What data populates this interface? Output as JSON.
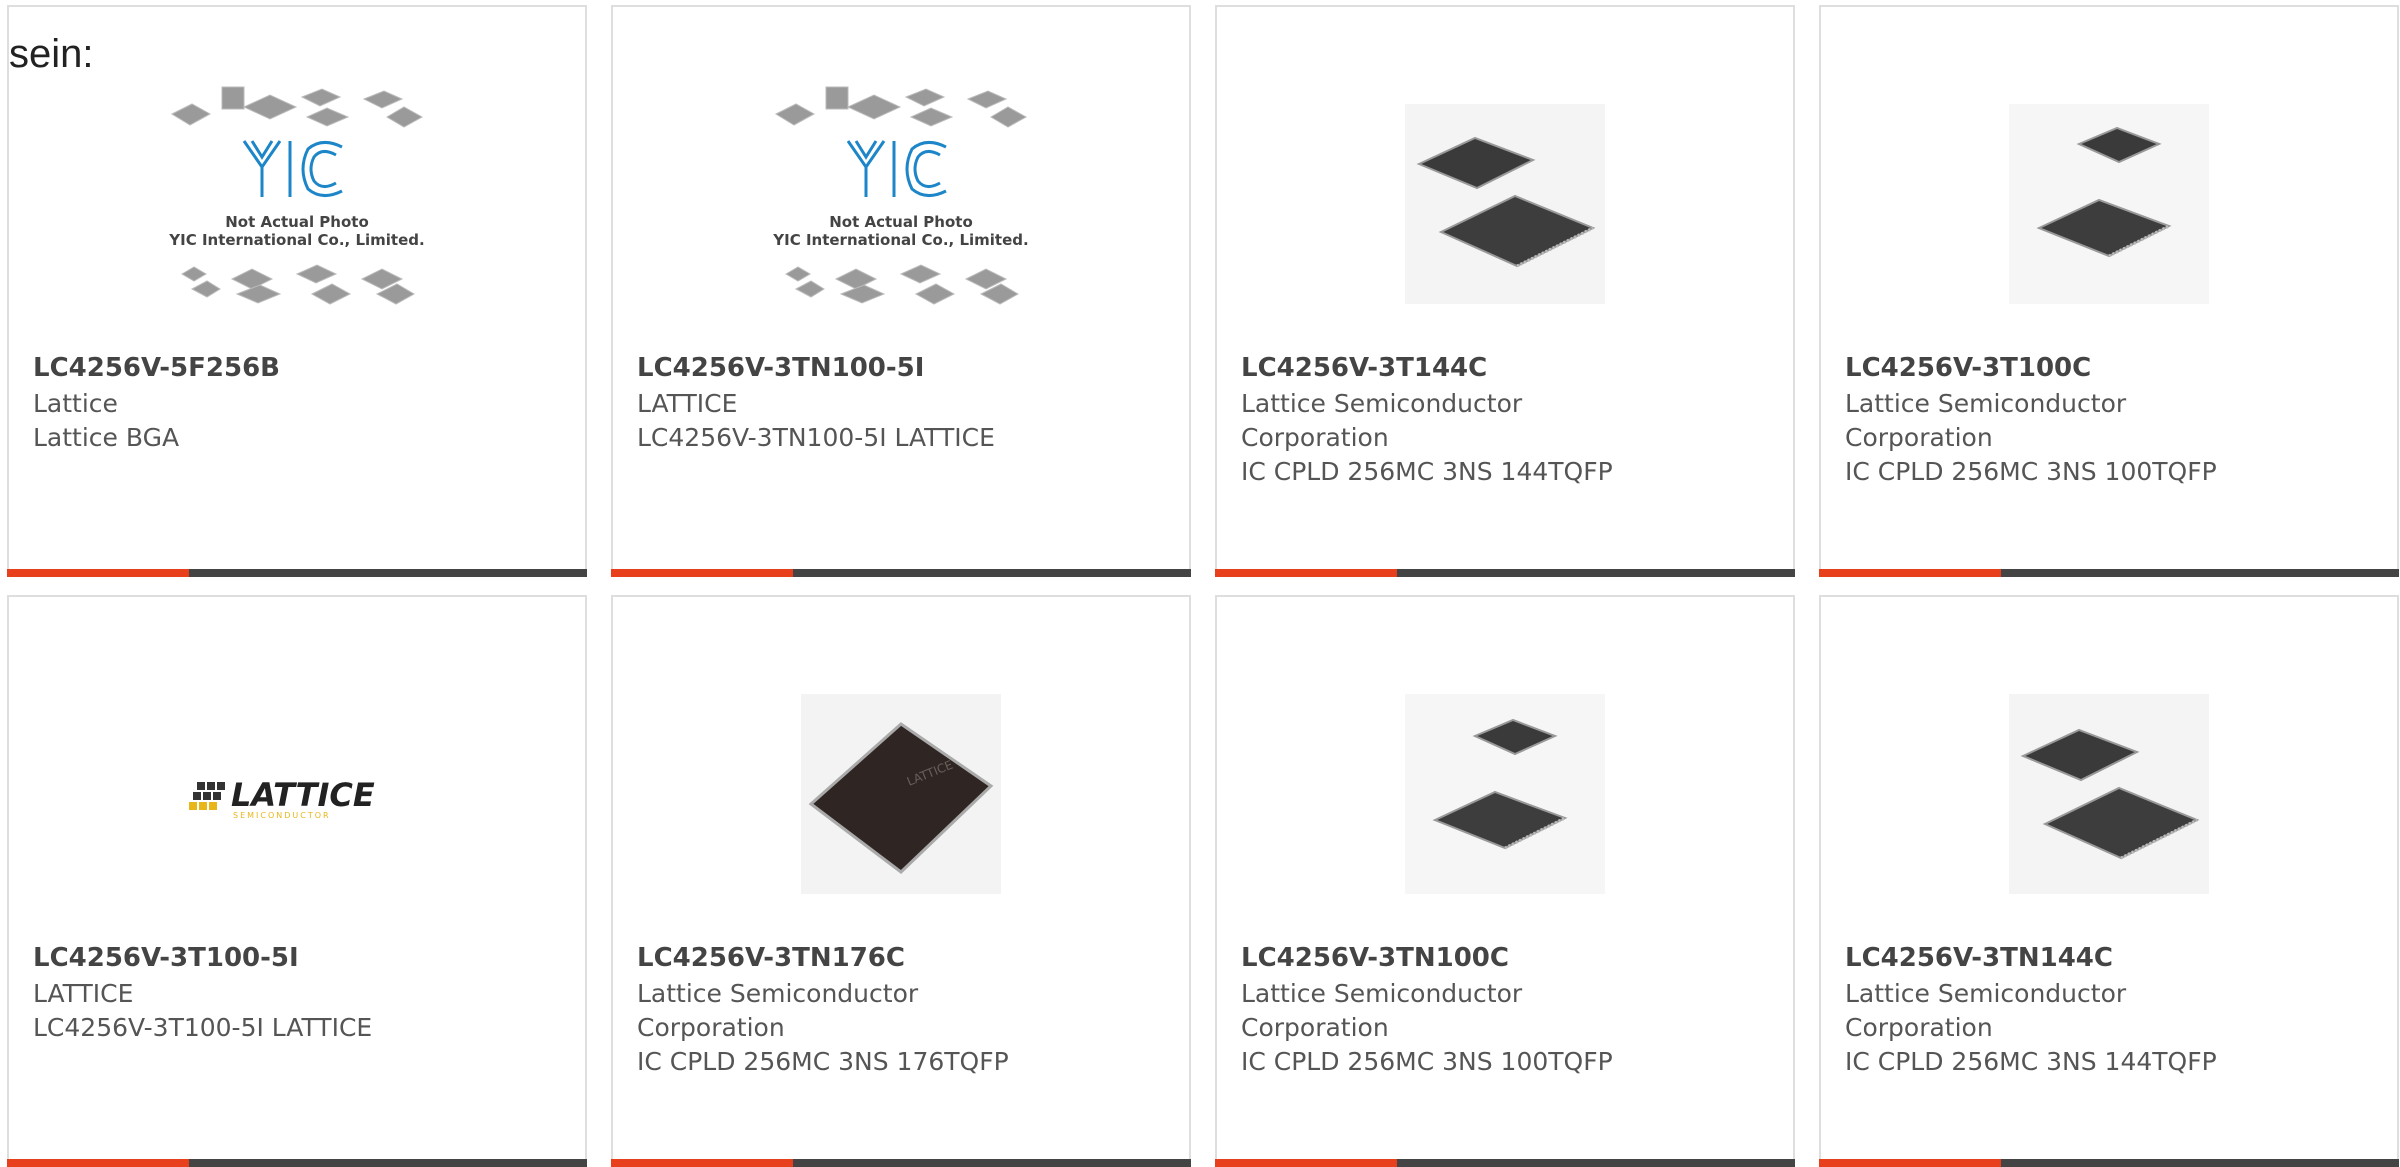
{
  "intro_text": "sein:",
  "colors": {
    "accent_bar": "#e8401c",
    "dark_bar": "#444444"
  },
  "placeholder_image": {
    "logo_text": "YIC",
    "caption_line1": "Not Actual Photo",
    "caption_line2": "YIC International Co., Limited."
  },
  "lattice_logo": {
    "brand": "LATTICE",
    "sub": "SEMICONDUCTOR"
  },
  "products": [
    {
      "part": "LC4256V-5F256B",
      "line1": "Lattice",
      "line2": "Lattice BGA",
      "line3": "",
      "image": "placeholder"
    },
    {
      "part": "LC4256V-3TN100-5I",
      "line1": "LATTICE",
      "line2": "LC4256V-3TN100-5I LATTICE",
      "line3": "",
      "image": "placeholder"
    },
    {
      "part": "LC4256V-3T144C",
      "line1": "Lattice Semiconductor",
      "line2": "Corporation",
      "line3": "IC CPLD 256MC 3NS 144TQFP",
      "image": "chip-pair"
    },
    {
      "part": "LC4256V-3T100C",
      "line1": "Lattice Semiconductor",
      "line2": "Corporation",
      "line3": "IC CPLD 256MC 3NS 100TQFP",
      "image": "chip-pair"
    },
    {
      "part": "LC4256V-3T100-5I",
      "line1": "LATTICE",
      "line2": "LC4256V-3T100-5I LATTICE",
      "line3": "",
      "image": "lattice-logo"
    },
    {
      "part": "LC4256V-3TN176C",
      "line1": "Lattice Semiconductor",
      "line2": "Corporation",
      "line3": "IC CPLD 256MC 3NS 176TQFP",
      "image": "single-chip"
    },
    {
      "part": "LC4256V-3TN100C",
      "line1": "Lattice Semiconductor",
      "line2": "Corporation",
      "line3": "IC CPLD 256MC 3NS 100TQFP",
      "image": "chip-pair"
    },
    {
      "part": "LC4256V-3TN144C",
      "line1": "Lattice Semiconductor",
      "line2": "Corporation",
      "line3": "IC CPLD 256MC 3NS 144TQFP",
      "image": "chip-pair"
    }
  ]
}
